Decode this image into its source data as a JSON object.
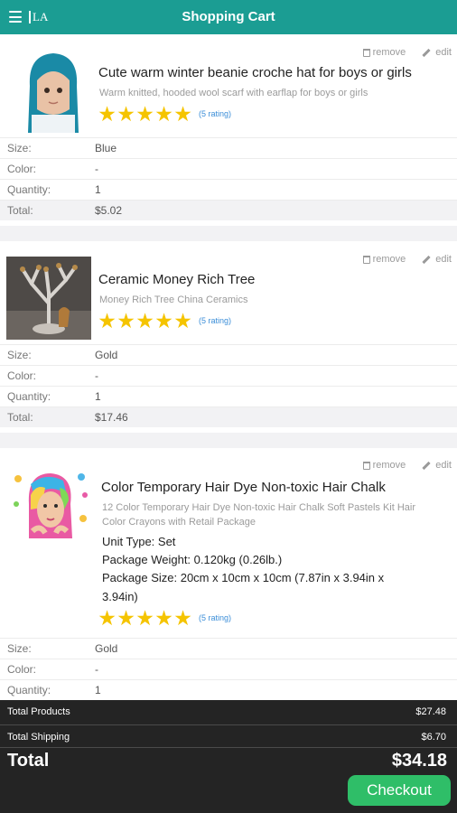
{
  "header": {
    "title": "Shopping Cart",
    "logo_text": "LA"
  },
  "actions": {
    "remove": "remove",
    "edit": "edit"
  },
  "labels": {
    "size": "Size:",
    "color": "Color:",
    "quantity": "Quantity:",
    "total": "Total:"
  },
  "items": [
    {
      "title": "Cute warm winter beanie croche hat for boys or girls",
      "description": "Warm knitted, hooded wool scarf with earflap for boys or girls",
      "rating_text": "(5 rating)",
      "stars": 5,
      "size": "Blue",
      "color": "-",
      "quantity": "1",
      "total": "$5.02"
    },
    {
      "title": "Ceramic Money Rich Tree",
      "description": "Money Rich Tree China Ceramics",
      "rating_text": "(5 rating)",
      "stars": 5,
      "size": "Gold",
      "color": "-",
      "quantity": "1",
      "total": "$17.46"
    },
    {
      "title": "Color Temporary Hair Dye Non-toxic Hair Chalk",
      "description": "12 Color Temporary Hair Dye Non-toxic Hair Chalk Soft Pastels Kit Hair Color Crayons with Retail Package",
      "spec_unit": "Unit Type: Set",
      "spec_weight": "Package Weight: 0.120kg (0.26lb.)",
      "spec_size": "Package Size: 20cm x 10cm x 10cm (7.87in x 3.94in x 3.94in)",
      "rating_text": "(5 rating)",
      "stars": 5,
      "size": "Gold",
      "color": "-",
      "quantity": "1"
    }
  ],
  "summary": {
    "total_products_label": "Total Products",
    "total_products_value": "$27.48",
    "total_shipping_label": "Total Shipping",
    "total_shipping_value": "$6.70",
    "total_label": "Total",
    "total_value": "$34.18",
    "checkout_label": "Checkout"
  },
  "colors": {
    "accent": "#1b9d93",
    "checkout": "#2fbe68",
    "star": "#f5c400",
    "link": "#3b8ed8",
    "summary_bg": "#242424"
  }
}
